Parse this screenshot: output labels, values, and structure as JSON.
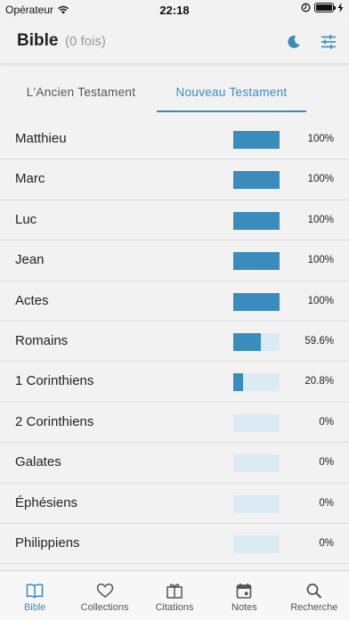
{
  "status": {
    "carrier": "Opérateur",
    "time": "22:18"
  },
  "header": {
    "title": "Bible",
    "count": "(0 fois)"
  },
  "tabs": [
    {
      "label": "L'Ancien Testament",
      "active": false
    },
    {
      "label": "Nouveau Testament",
      "active": true
    }
  ],
  "books": [
    {
      "name": "Matthieu",
      "progress": 1.0,
      "pct": "100%"
    },
    {
      "name": "Marc",
      "progress": 1.0,
      "pct": "100%"
    },
    {
      "name": "Luc",
      "progress": 1.0,
      "pct": "100%"
    },
    {
      "name": "Jean",
      "progress": 1.0,
      "pct": "100%"
    },
    {
      "name": "Actes",
      "progress": 1.0,
      "pct": "100%"
    },
    {
      "name": "Romains",
      "progress": 0.596,
      "pct": "59.6%"
    },
    {
      "name": "1 Corinthiens",
      "progress": 0.208,
      "pct": "20.8%"
    },
    {
      "name": "2 Corinthiens",
      "progress": 0,
      "pct": "0%"
    },
    {
      "name": "Galates",
      "progress": 0,
      "pct": "0%"
    },
    {
      "name": "Éphésiens",
      "progress": 0,
      "pct": "0%"
    },
    {
      "name": "Philippiens",
      "progress": 0,
      "pct": "0%"
    }
  ],
  "tabbar": [
    {
      "label": "Bible",
      "icon": "book-icon",
      "active": true
    },
    {
      "label": "Collections",
      "icon": "heart-icon",
      "active": false
    },
    {
      "label": "Citations",
      "icon": "gift-icon",
      "active": false
    },
    {
      "label": "Notes",
      "icon": "calendar-icon",
      "active": false
    },
    {
      "label": "Recherche",
      "icon": "search-icon",
      "active": false
    }
  ],
  "colors": {
    "accent": "#3a8cbd",
    "bar_track": "#dcebf3"
  }
}
